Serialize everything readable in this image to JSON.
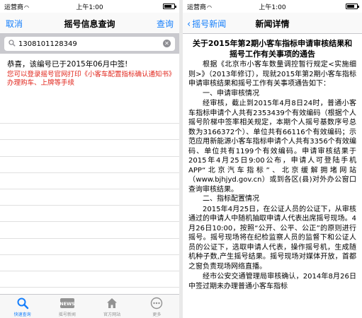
{
  "left": {
    "status": {
      "carrier": "运营商",
      "time": "上午1:00",
      "battery_fraction": 0.8
    },
    "nav": {
      "title": "摇号信息查询",
      "cancel": "取消",
      "query": "查询"
    },
    "search": {
      "value": "1308101128349"
    },
    "result": {
      "message": "恭喜，该编号已于2015年06月中签!",
      "tip": "您可以登录摇号官网打印《小客车配置指标确认通知书》办理购车、上牌等手续"
    },
    "tabs": [
      {
        "label": "快速查询",
        "icon": "search-icon",
        "active": true
      },
      {
        "label": "摇号新闻",
        "icon": "news-icon",
        "active": false
      },
      {
        "label": "官方网站",
        "icon": "home-icon",
        "active": false
      },
      {
        "label": "更多",
        "icon": "more-icon",
        "active": false
      }
    ],
    "colors": {
      "accent": "#147efb",
      "alert": "#e1251b"
    }
  },
  "right": {
    "status": {
      "carrier": "运营商",
      "time": "上午1:00",
      "battery_fraction": 0.8
    },
    "nav": {
      "back": "摇号新闻",
      "title": "新闻详情"
    },
    "article": {
      "title": "关于2015年第2期小客车指标申请审核结果和摇号工作有关事项的通告",
      "p1": "根据《北京市小客车数量调控暂行规定<实施细则>》（2013年修订），现就2015年第2期小客车指标申请审核结果和摇号工作有关事项通告如下：",
      "h1": "一、申请审核情况",
      "p2": "经审核，截止到2015年4月8日24时，普通小客车指标申请个人共有2353439个有效编码（根据个人摇号阶梯中签率相关规定，本期个人摇号基数序号总数为3166372个）、单位共有66116个有效编码；示范应用新能源小客车指标申请个人共有3356个有效编码、单位共有1199个有效编码。申请审核结果于2015年4月25日9:00公布，申请人可登陆手机APP“北京汽车指标”、北京缓解拥堵网站（www.bjhjyd.gov.cn）或到各区(县)对外办公窗口查询审核结果。",
      "h2": "二、指标配置情况",
      "p3": "2015年4月25日，在公证人员的公证下，从审核通过的申请人中随机抽取申请人代表出席摇号现场。4月26日10:00，按照“公开、公平、公正”的原则进行摇号。摇号现场将在纪检监察人员的监督下和公证人员的公证下，选取申请人代表，操作摇号机，生成随机种子数,产生摇号结果。摇号现场对媒体开放，首都之窗负责现场网络直播。",
      "p4": "经市公安交通管理局审核确认，2014年8月26日中签过期未办理普通小客车指标"
    }
  }
}
